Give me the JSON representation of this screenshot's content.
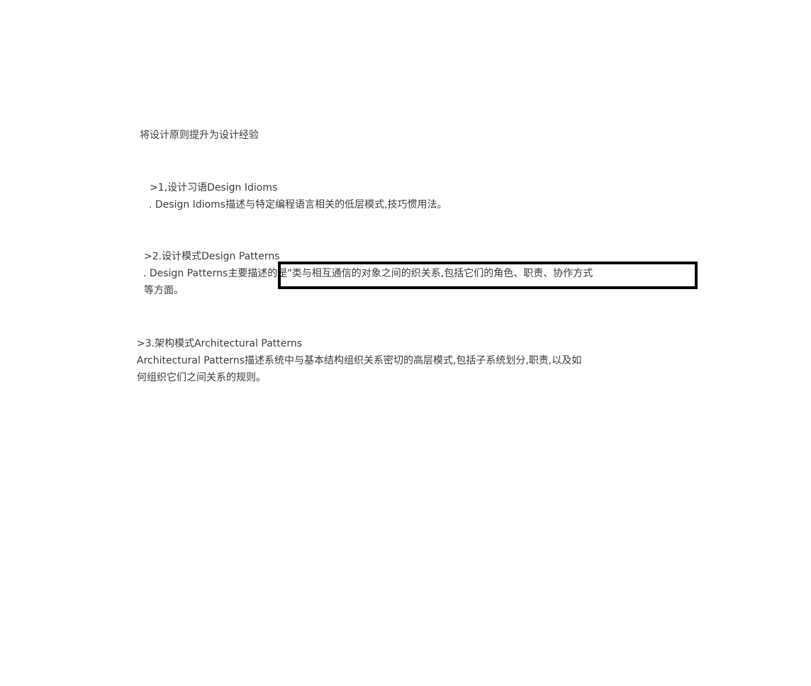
{
  "intro": {
    "text": "将设计原则提升为设计经验"
  },
  "section1": {
    "heading": ">1,设计习语Design Idioms",
    "body": ". Design Idioms描述与特定编程语言相关的低层模式,技巧惯用法。"
  },
  "section2": {
    "heading": ">2.设计模式Design Patterns",
    "body_prefix": ". Design Patterns主要描述的是",
    "body_highlighted": "\"类与相互通信的对象之间的织关系,包括它们的角色、职责、协作方式",
    "body_continuation": "等方面。"
  },
  "section3": {
    "heading": ">3.架构模式Architectural Patterns",
    "body_line1": "Architectural Patterns描述系统中与基本结构组织关系密切的高层模式,包括子系统划分,职责,以及如",
    "body_line2": "何组织它们之间关系的规则。"
  }
}
